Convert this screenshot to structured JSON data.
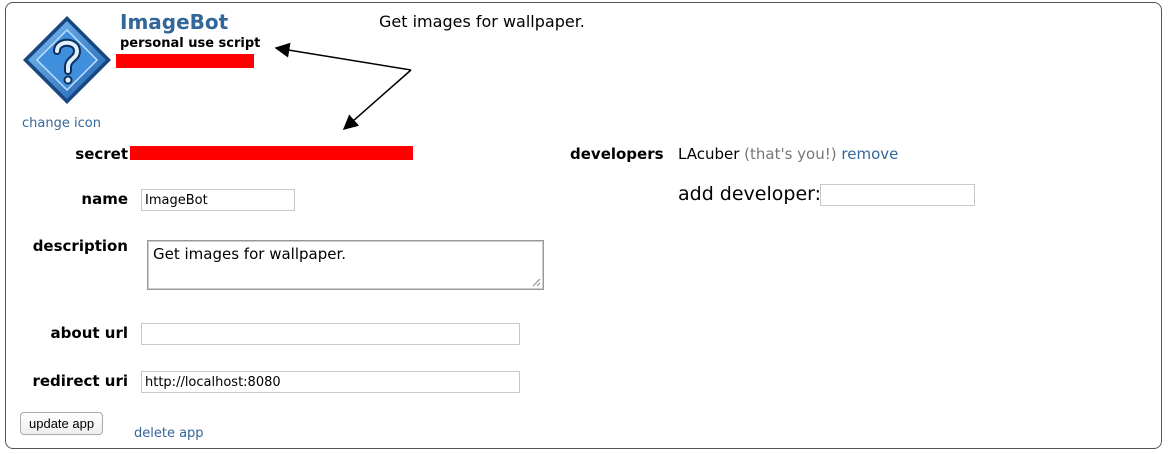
{
  "app": {
    "name": "ImageBot",
    "type": "personal use script",
    "top_description": "Get images for wallpaper.",
    "change_icon_label": "change icon"
  },
  "form": {
    "secret_label": "secret",
    "name_label": "name",
    "name_value": "ImageBot",
    "description_label": "description",
    "description_value": "Get images for wallpaper.",
    "about_url_label": "about url",
    "about_url_value": "",
    "redirect_uri_label": "redirect uri",
    "redirect_uri_value": "http://localhost:8080",
    "update_button": "update app",
    "delete_link": "delete app"
  },
  "developers": {
    "label": "developers",
    "name": "LAcuber",
    "note": "(that's you!)",
    "remove_label": "remove",
    "add_label": "add developer:",
    "add_value": ""
  },
  "colors": {
    "link": "#336699",
    "redaction": "#ff0000",
    "icon_blue": "#2f7fd0"
  }
}
